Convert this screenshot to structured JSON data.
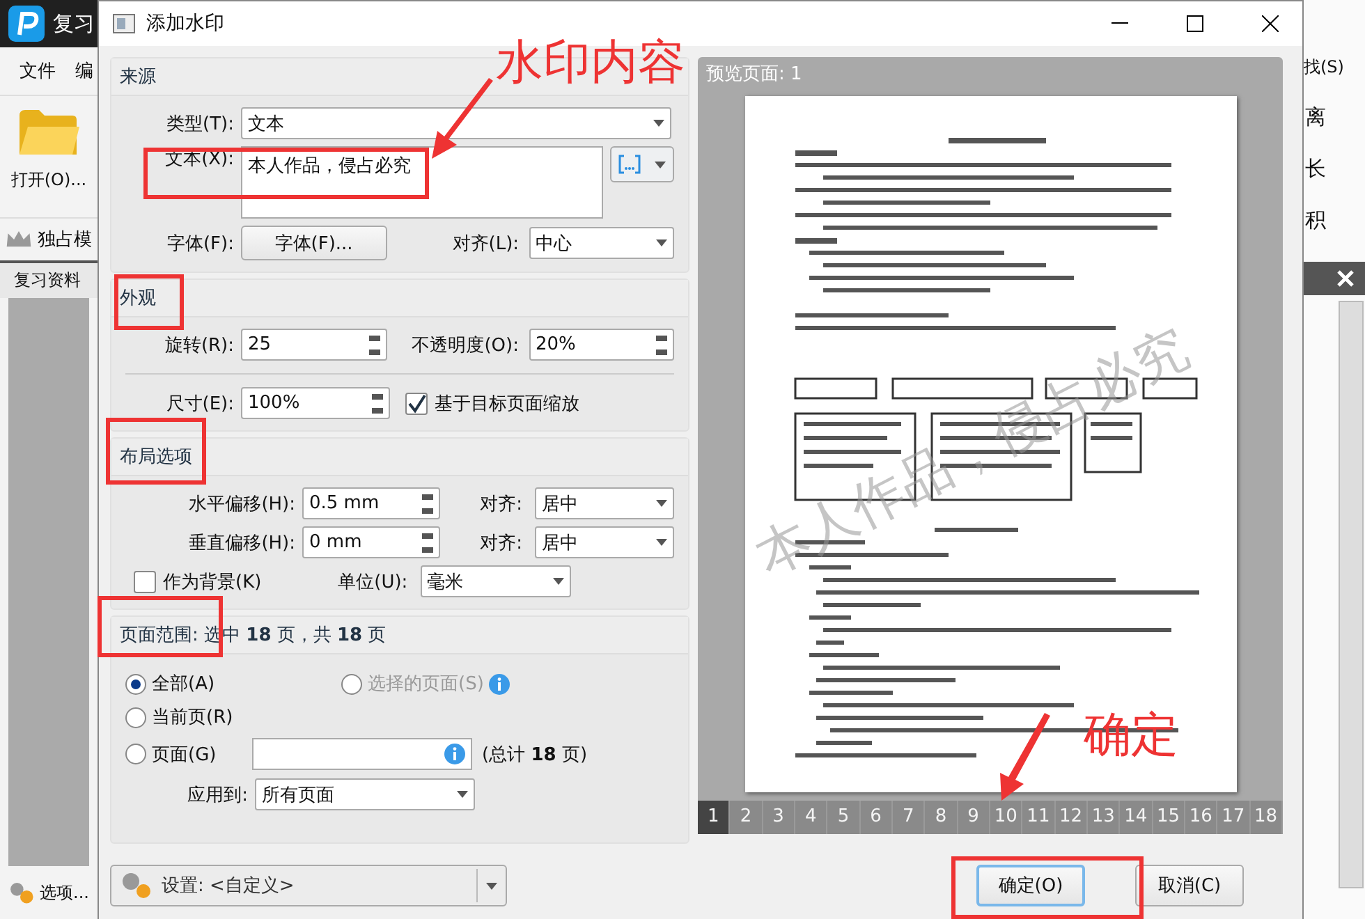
{
  "app": {
    "title": "复习",
    "menu": [
      "文件",
      "编"
    ],
    "open_button": "打开(O)...",
    "template_item": "独占模",
    "tab": "复习资料",
    "options_button": "选项...",
    "right_items": [
      "找(S)",
      "离",
      "长",
      "积"
    ]
  },
  "dialog": {
    "title": "添加水印",
    "source": {
      "heading": "来源",
      "type_label": "类型(T):",
      "type_value": "文本",
      "text_label": "文本(X):",
      "text_value": "本人作品，侵占必究",
      "font_label": "字体(F):",
      "font_button": "字体(F)...",
      "align_label": "对齐(L):",
      "align_value": "中心"
    },
    "appearance": {
      "heading": "外观",
      "rotation_label": "旋转(R):",
      "rotation_value": "25",
      "opacity_label": "不透明度(O):",
      "opacity_value": "20%",
      "size_label": "尺寸(E):",
      "size_value": "100%",
      "scale_checkbox": {
        "label": "基于目标页面缩放",
        "checked": true
      }
    },
    "layout": {
      "heading": "布局选项",
      "rows": [
        {
          "label": "水平偏移(H):",
          "value": "0.5 mm",
          "align_label": "对齐:",
          "align_value": "居中"
        },
        {
          "label": "垂直偏移(H):",
          "value": "0 mm",
          "align_label": "对齐:",
          "align_value": "居中"
        }
      ],
      "background_checkbox": {
        "label": "作为背景(K)",
        "checked": false
      },
      "unit_label": "单位(U):",
      "unit_value": "毫米"
    },
    "page_range": {
      "heading": "页面范围: 选中 **18** 页，共 **18** 页",
      "options": [
        {
          "label": "全部(A)",
          "selected": true,
          "disabled": false
        },
        {
          "label": "选择的页面(S)",
          "selected": false,
          "disabled": true
        },
        {
          "label": "当前页(R)",
          "selected": false,
          "disabled": false
        },
        {
          "label": "页面(G)",
          "selected": false,
          "disabled": false
        }
      ],
      "total": "(总计 **18** 页)",
      "apply_label": "应用到:",
      "apply_value": "所有页面"
    },
    "preview": {
      "heading": "预览页面: 1",
      "watermark": "本人作品，侵占必究",
      "pages": [
        {
          "label": "1",
          "selected": true
        },
        {
          "label": "2",
          "selected": false
        },
        {
          "label": "3",
          "selected": false
        },
        {
          "label": "4",
          "selected": false
        },
        {
          "label": "5",
          "selected": false
        },
        {
          "label": "6",
          "selected": false
        },
        {
          "label": "7",
          "selected": false
        },
        {
          "label": "8",
          "selected": false
        },
        {
          "label": "9",
          "selected": false
        },
        {
          "label": "10",
          "selected": false
        },
        {
          "label": "11",
          "selected": false
        },
        {
          "label": "12",
          "selected": false
        },
        {
          "label": "13",
          "selected": false
        },
        {
          "label": "14",
          "selected": false
        },
        {
          "label": "15",
          "selected": false
        },
        {
          "label": "16",
          "selected": false
        },
        {
          "label": "17",
          "selected": false
        },
        {
          "label": "18",
          "selected": false
        }
      ]
    },
    "settings": "设置: <自定义>",
    "ok_button": "确定(O)",
    "cancel_button": "取消(C)"
  },
  "annotations": [
    {
      "label": "水印内容"
    },
    {
      "label": "确定"
    }
  ]
}
